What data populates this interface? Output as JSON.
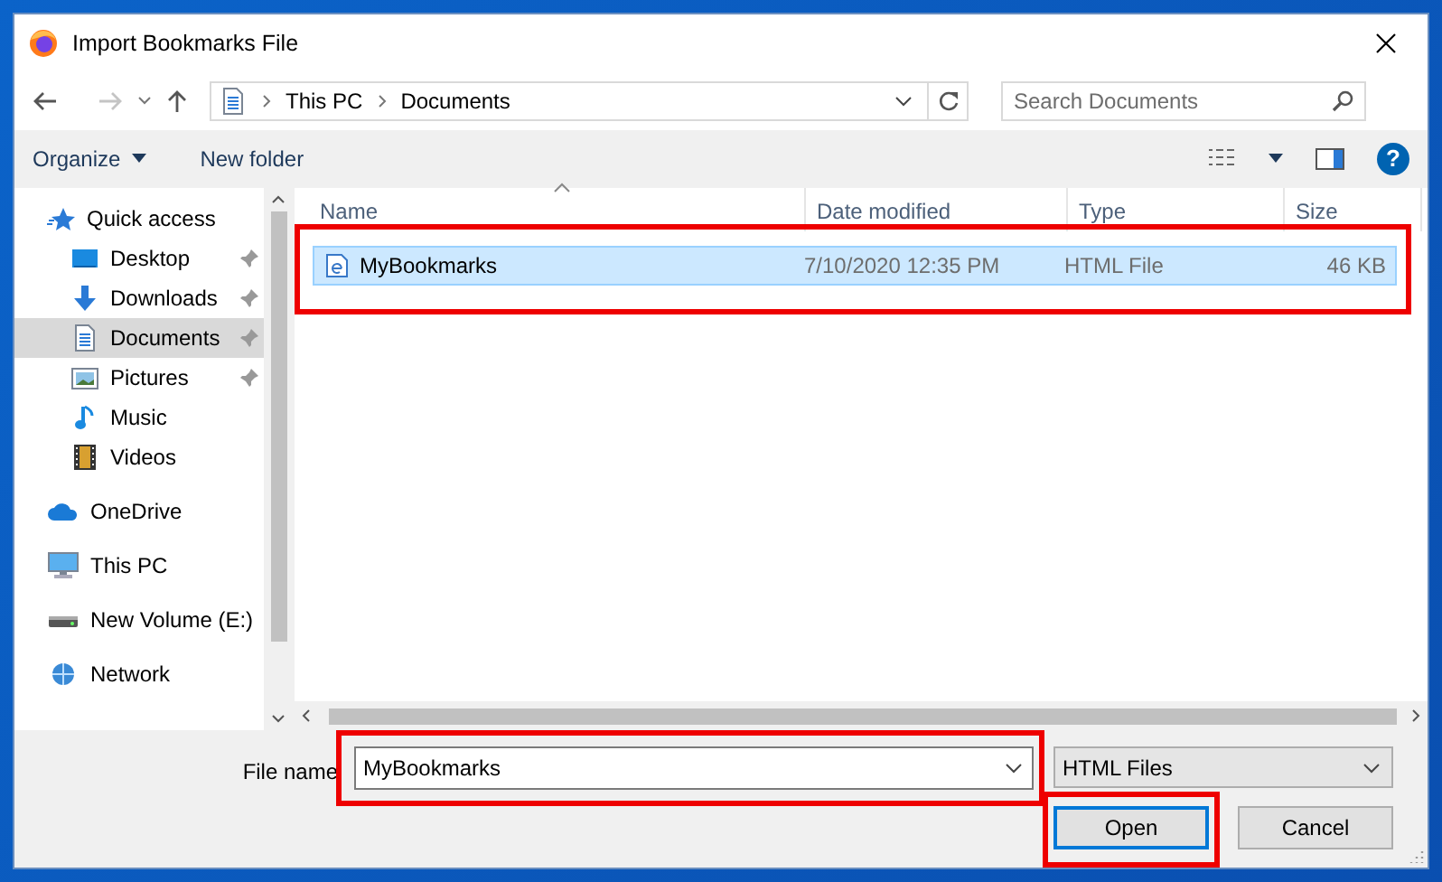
{
  "window": {
    "title": "Import Bookmarks File"
  },
  "address_bar": {
    "path": [
      "This PC",
      "Documents"
    ]
  },
  "search": {
    "placeholder": "Search Documents"
  },
  "toolbar": {
    "organize": "Organize",
    "new_folder": "New folder",
    "help": "?"
  },
  "sidebar": {
    "items": [
      {
        "label": "Quick access",
        "kind": "star",
        "selected": false,
        "pinned": false,
        "children": [
          {
            "label": "Desktop",
            "kind": "desktop",
            "selected": false,
            "pinned": true
          },
          {
            "label": "Downloads",
            "kind": "download",
            "selected": false,
            "pinned": true
          },
          {
            "label": "Documents",
            "kind": "document",
            "selected": true,
            "pinned": true
          },
          {
            "label": "Pictures",
            "kind": "picture",
            "selected": false,
            "pinned": true
          },
          {
            "label": "Music",
            "kind": "music",
            "selected": false,
            "pinned": false
          },
          {
            "label": "Videos",
            "kind": "video",
            "selected": false,
            "pinned": false
          }
        ]
      },
      {
        "label": "OneDrive",
        "kind": "cloud",
        "selected": false,
        "pinned": false
      },
      {
        "label": "This PC",
        "kind": "computer",
        "selected": false,
        "pinned": false
      },
      {
        "label": "New Volume (E:)",
        "kind": "drive",
        "selected": false,
        "pinned": false
      },
      {
        "label": "Network",
        "kind": "network",
        "selected": false,
        "pinned": false
      }
    ]
  },
  "table": {
    "columns": [
      {
        "label": "Name",
        "sorted": true
      },
      {
        "label": "Date modified",
        "sorted": false
      },
      {
        "label": "Type",
        "sorted": false
      },
      {
        "label": "Size",
        "sorted": false
      }
    ],
    "rows": [
      {
        "name": "MyBookmarks",
        "date": "7/10/2020 12:35 PM",
        "type": "HTML File",
        "size": "46 KB",
        "selected": true,
        "highlighted": true
      }
    ]
  },
  "footer": {
    "file_name_label": "File name",
    "file_name": {
      "value": "MyBookmarks",
      "highlighted": true
    },
    "file_type": "HTML Files",
    "buttons": [
      {
        "label": "Open",
        "default": true,
        "highlighted": true
      },
      {
        "label": "Cancel",
        "default": false,
        "highlighted": false
      }
    ]
  }
}
